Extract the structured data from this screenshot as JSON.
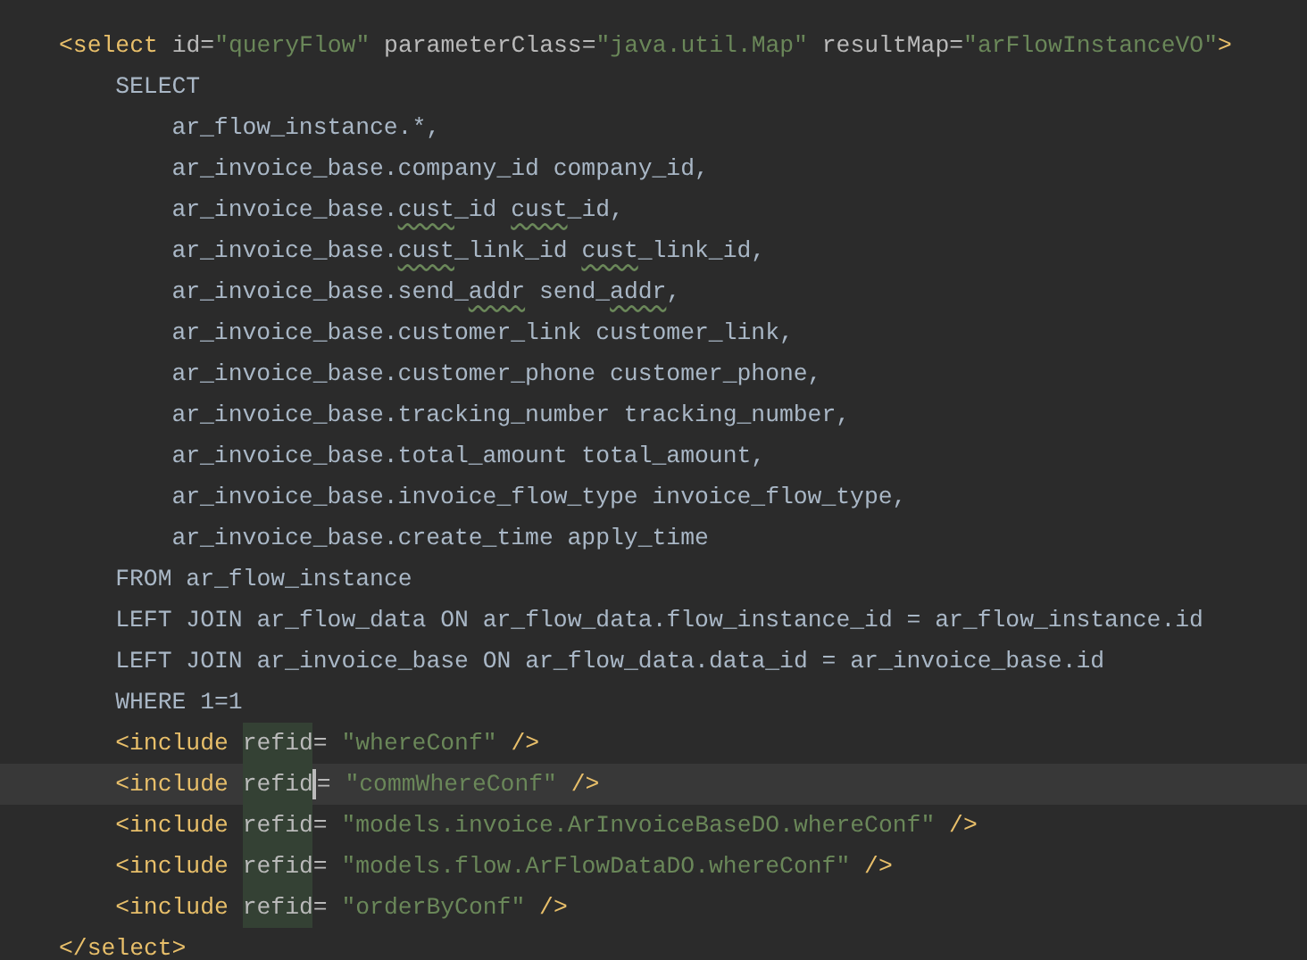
{
  "editor": {
    "lines": [
      {
        "current": false,
        "tokens": [
          {
            "kind": "tag",
            "text": "<select "
          },
          {
            "kind": "attr",
            "text": "id"
          },
          {
            "kind": "attr",
            "text": "="
          },
          {
            "kind": "str",
            "text": "\"queryFlow\""
          },
          {
            "kind": "attr",
            "text": " parameterClass"
          },
          {
            "kind": "attr",
            "text": "="
          },
          {
            "kind": "str",
            "text": "\"java.util.Map\""
          },
          {
            "kind": "attr",
            "text": " resultMap"
          },
          {
            "kind": "attr",
            "text": "="
          },
          {
            "kind": "str",
            "text": "\"arFlowInstanceVO\""
          },
          {
            "kind": "tag",
            "text": ">"
          }
        ],
        "children": [
          {
            "current": false,
            "tokens": [
              {
                "kind": "text",
                "text": "SELECT"
              }
            ],
            "children": [
              {
                "current": false,
                "tokens": [
                  {
                    "kind": "text",
                    "text": "ar_flow_instance.*,"
                  }
                ]
              },
              {
                "current": false,
                "tokens": [
                  {
                    "kind": "text",
                    "text": "ar_invoice_base.company_id company_id,"
                  }
                ]
              },
              {
                "current": false,
                "tokens": [
                  {
                    "kind": "text",
                    "text": "ar_invoice_base."
                  },
                  {
                    "kind": "typo",
                    "text": "cust"
                  },
                  {
                    "kind": "text",
                    "text": "_id "
                  },
                  {
                    "kind": "typo",
                    "text": "cust"
                  },
                  {
                    "kind": "text",
                    "text": "_id,"
                  }
                ]
              },
              {
                "current": false,
                "tokens": [
                  {
                    "kind": "text",
                    "text": "ar_invoice_base."
                  },
                  {
                    "kind": "typo",
                    "text": "cust"
                  },
                  {
                    "kind": "text",
                    "text": "_link_id "
                  },
                  {
                    "kind": "typo",
                    "text": "cust"
                  },
                  {
                    "kind": "text",
                    "text": "_link_id,"
                  }
                ]
              },
              {
                "current": false,
                "tokens": [
                  {
                    "kind": "text",
                    "text": "ar_invoice_base.send_"
                  },
                  {
                    "kind": "typo",
                    "text": "addr"
                  },
                  {
                    "kind": "text",
                    "text": " send_"
                  },
                  {
                    "kind": "typo",
                    "text": "addr"
                  },
                  {
                    "kind": "text",
                    "text": ","
                  }
                ]
              },
              {
                "current": false,
                "tokens": [
                  {
                    "kind": "text",
                    "text": "ar_invoice_base.customer_link customer_link,"
                  }
                ]
              },
              {
                "current": false,
                "tokens": [
                  {
                    "kind": "text",
                    "text": "ar_invoice_base.customer_phone customer_phone,"
                  }
                ]
              },
              {
                "current": false,
                "tokens": [
                  {
                    "kind": "text",
                    "text": "ar_invoice_base.tracking_number tracking_number,"
                  }
                ]
              },
              {
                "current": false,
                "tokens": [
                  {
                    "kind": "text",
                    "text": "ar_invoice_base.total_amount total_amount,"
                  }
                ]
              },
              {
                "current": false,
                "tokens": [
                  {
                    "kind": "text",
                    "text": "ar_invoice_base.invoice_flow_type invoice_flow_type,"
                  }
                ]
              },
              {
                "current": false,
                "tokens": [
                  {
                    "kind": "text",
                    "text": "ar_invoice_base.create_time apply_time"
                  }
                ]
              }
            ]
          },
          {
            "current": false,
            "tokens": [
              {
                "kind": "text",
                "text": "FROM ar_flow_instance"
              }
            ]
          },
          {
            "current": false,
            "tokens": [
              {
                "kind": "text",
                "text": "LEFT JOIN ar_flow_data ON ar_flow_data.flow_instance_id = ar_flow_instance.id"
              }
            ]
          },
          {
            "current": false,
            "tokens": [
              {
                "kind": "text",
                "text": "LEFT JOIN ar_invoice_base ON ar_flow_data.data_id = ar_invoice_base.id"
              }
            ]
          },
          {
            "current": false,
            "tokens": [
              {
                "kind": "text",
                "text": "WHERE 1=1"
              }
            ]
          },
          {
            "current": false,
            "tokens": [
              {
                "kind": "tag",
                "text": "<include "
              },
              {
                "kind": "match",
                "text": "refid"
              },
              {
                "kind": "attr",
                "text": "= "
              },
              {
                "kind": "str",
                "text": "\"whereConf\""
              },
              {
                "kind": "tag",
                "text": " />"
              }
            ]
          },
          {
            "current": true,
            "tokens": [
              {
                "kind": "tag",
                "text": "<include "
              },
              {
                "kind": "match",
                "text": "refid"
              },
              {
                "kind": "caret"
              },
              {
                "kind": "attr",
                "text": "= "
              },
              {
                "kind": "str",
                "text": "\"commWhereConf\""
              },
              {
                "kind": "tag",
                "text": " />"
              }
            ]
          },
          {
            "current": false,
            "tokens": [
              {
                "kind": "tag",
                "text": "<include "
              },
              {
                "kind": "match",
                "text": "refid"
              },
              {
                "kind": "attr",
                "text": "= "
              },
              {
                "kind": "str",
                "text": "\"models.invoice.ArInvoiceBaseDO.whereConf\""
              },
              {
                "kind": "tag",
                "text": " />"
              }
            ]
          },
          {
            "current": false,
            "tokens": [
              {
                "kind": "tag",
                "text": "<include "
              },
              {
                "kind": "match",
                "text": "refid"
              },
              {
                "kind": "attr",
                "text": "= "
              },
              {
                "kind": "str",
                "text": "\"models.flow.ArFlowDataDO.whereConf\""
              },
              {
                "kind": "tag",
                "text": " />"
              }
            ]
          },
          {
            "current": false,
            "tokens": [
              {
                "kind": "tag",
                "text": "<include "
              },
              {
                "kind": "match",
                "text": "refid"
              },
              {
                "kind": "attr",
                "text": "= "
              },
              {
                "kind": "str",
                "text": "\"orderByConf\""
              },
              {
                "kind": "tag",
                "text": " />"
              }
            ]
          }
        ]
      },
      {
        "current": false,
        "tokens": [
          {
            "kind": "tag",
            "text": "</select>"
          }
        ]
      }
    ]
  }
}
